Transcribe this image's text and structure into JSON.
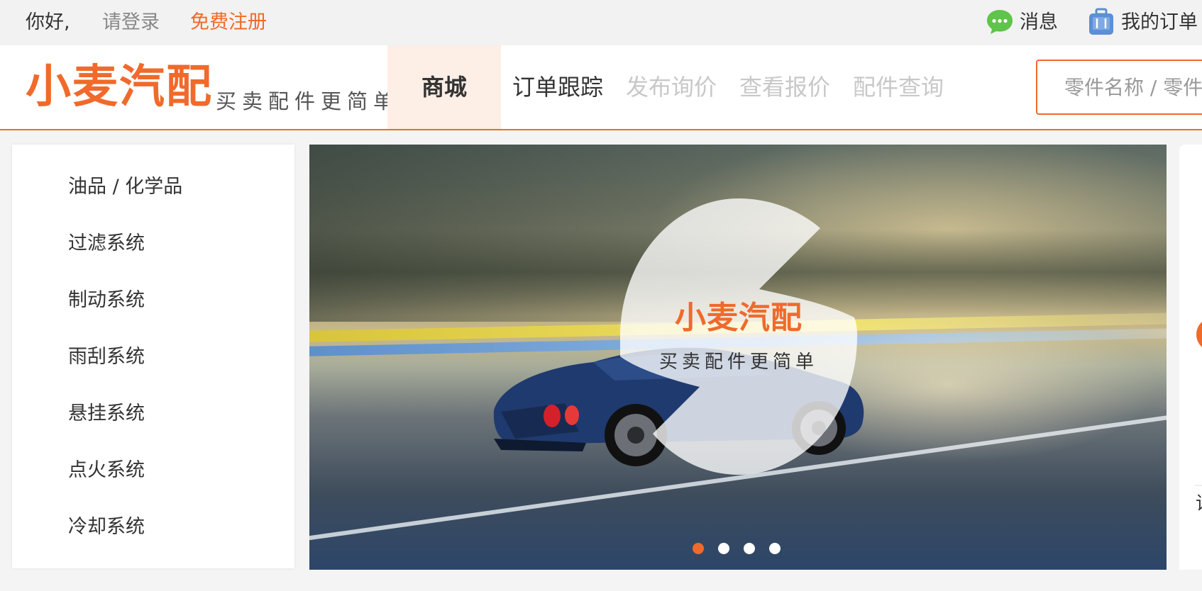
{
  "topbar": {
    "greeting": "你好,",
    "login": "请登录",
    "register": "免费注册",
    "messages": "消息",
    "orders": "我的订单",
    "message_icon": "chat-bubble-icon",
    "order_icon": "suitcase-icon"
  },
  "header": {
    "logo": "小麦汽配",
    "slogan": "买卖配件更简单",
    "nav": [
      "商城",
      "订单跟踪",
      "发布询价",
      "查看报价",
      "配件查询"
    ],
    "active_nav": "商城",
    "search_placeholder": "零件名称 / 零件号"
  },
  "sidebar": {
    "categories": [
      "油品 / 化学品",
      "过滤系统",
      "制动系统",
      "雨刮系统",
      "悬挂系统",
      "点火系统",
      "冷却系统"
    ]
  },
  "banner": {
    "logo": "小麦汽配",
    "slogan": "买卖配件更简单",
    "slide_count": 4,
    "active_slide": 1
  },
  "right_panel": {
    "peek_text": "请"
  },
  "colors": {
    "accent": "#f06a2b",
    "nav_active_bg": "#fdeee6",
    "disabled_text": "#c8c8c8",
    "message_icon_green": "#5fc44a",
    "order_icon_blue": "#5b8fd6"
  }
}
